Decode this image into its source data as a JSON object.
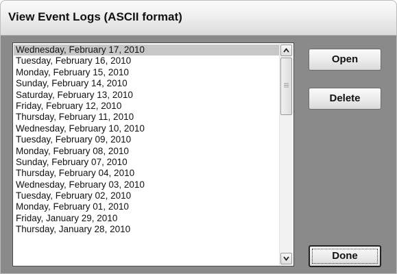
{
  "window": {
    "title": "View Event Logs (ASCII format)"
  },
  "log_list": {
    "selected_index": 0,
    "items": [
      "Wednesday, February 17, 2010",
      "Tuesday, February 16, 2010",
      "Monday, February 15, 2010",
      "Sunday, February 14, 2010",
      "Saturday, February 13, 2010",
      "Friday, February 12, 2010",
      "Thursday, February 11, 2010",
      "Wednesday, February 10, 2010",
      "Tuesday, February 09, 2010",
      "Monday, February 08, 2010",
      "Sunday, February 07, 2010",
      "Thursday, February 04, 2010",
      "Wednesday, February 03, 2010",
      "Tuesday, February 02, 2010",
      "Monday, February 01, 2010",
      "Friday, January 29, 2010",
      "Thursday, January 28, 2010"
    ]
  },
  "scrollbar": {
    "up_icon": "chevron-up-icon",
    "down_icon": "chevron-down-icon"
  },
  "buttons": {
    "open_label": "Open",
    "delete_label": "Delete",
    "done_label": "Done"
  }
}
